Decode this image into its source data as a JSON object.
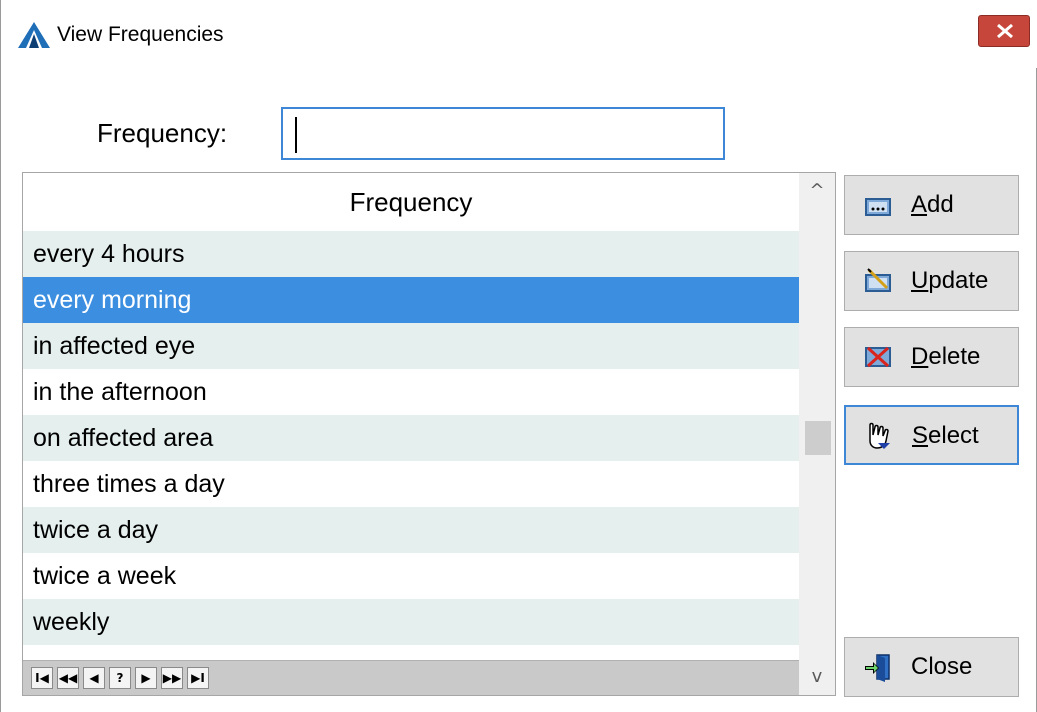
{
  "window": {
    "title": "View Frequencies",
    "close_glyph": "×"
  },
  "filter": {
    "label": "Frequency:",
    "value": ""
  },
  "grid": {
    "column_header": "Frequency",
    "rows": [
      "every 4 hours",
      "every morning",
      "in affected eye",
      "in the afternoon",
      "on affected area",
      "three times a day",
      "twice a day",
      "twice a week",
      "weekly"
    ],
    "selected_index": 1,
    "navigator": [
      "I◀",
      "◀◀",
      "◀",
      "?",
      "▶",
      "▶▶",
      "▶I"
    ],
    "scroll_up": "^",
    "scroll_down": "v"
  },
  "buttons": {
    "add": {
      "mnemonic": "A",
      "rest": "dd",
      "icon": "add-icon"
    },
    "update": {
      "mnemonic": "U",
      "rest": "pdate",
      "icon": "update-icon"
    },
    "delete": {
      "mnemonic": "D",
      "rest": "elete",
      "icon": "delete-icon"
    },
    "select": {
      "mnemonic": "S",
      "rest": "elect",
      "icon": "hand-pointer-icon"
    },
    "close": {
      "label": "Close",
      "icon": "exit-door-icon"
    }
  },
  "colors": {
    "selection": "#3b8ee0",
    "alt_row": "#e4efee",
    "focus_border": "#3e86d6",
    "close_red": "#c7463b"
  }
}
